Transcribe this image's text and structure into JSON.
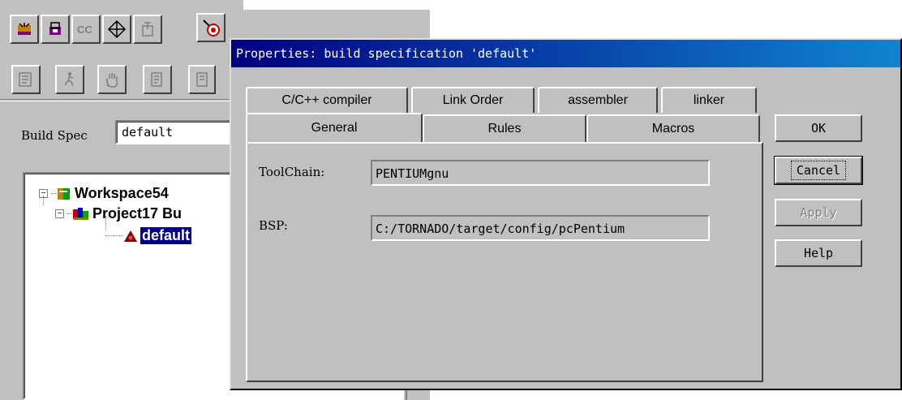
{
  "ide": {
    "build_spec_label": "Build Spec",
    "build_spec_value": "default",
    "tree": {
      "workspace": "Workspace54",
      "project": "Project17 Bu",
      "spec": "default"
    }
  },
  "dialog": {
    "title": "Properties: build specification 'default'",
    "tabs_back": [
      "C/C++ compiler",
      "Link Order",
      "assembler",
      "linker"
    ],
    "tabs_front": [
      "General",
      "Rules",
      "Macros"
    ],
    "active_tab": "General",
    "fields": {
      "toolchain_label": "ToolChain:",
      "toolchain_value": "PENTIUMgnu",
      "bsp_label": "BSP:",
      "bsp_value": "C:/TORNADO/target/config/pcPentium"
    },
    "buttons": {
      "ok": "OK",
      "cancel": "Cancel",
      "apply": "Apply",
      "help": "Help"
    }
  }
}
